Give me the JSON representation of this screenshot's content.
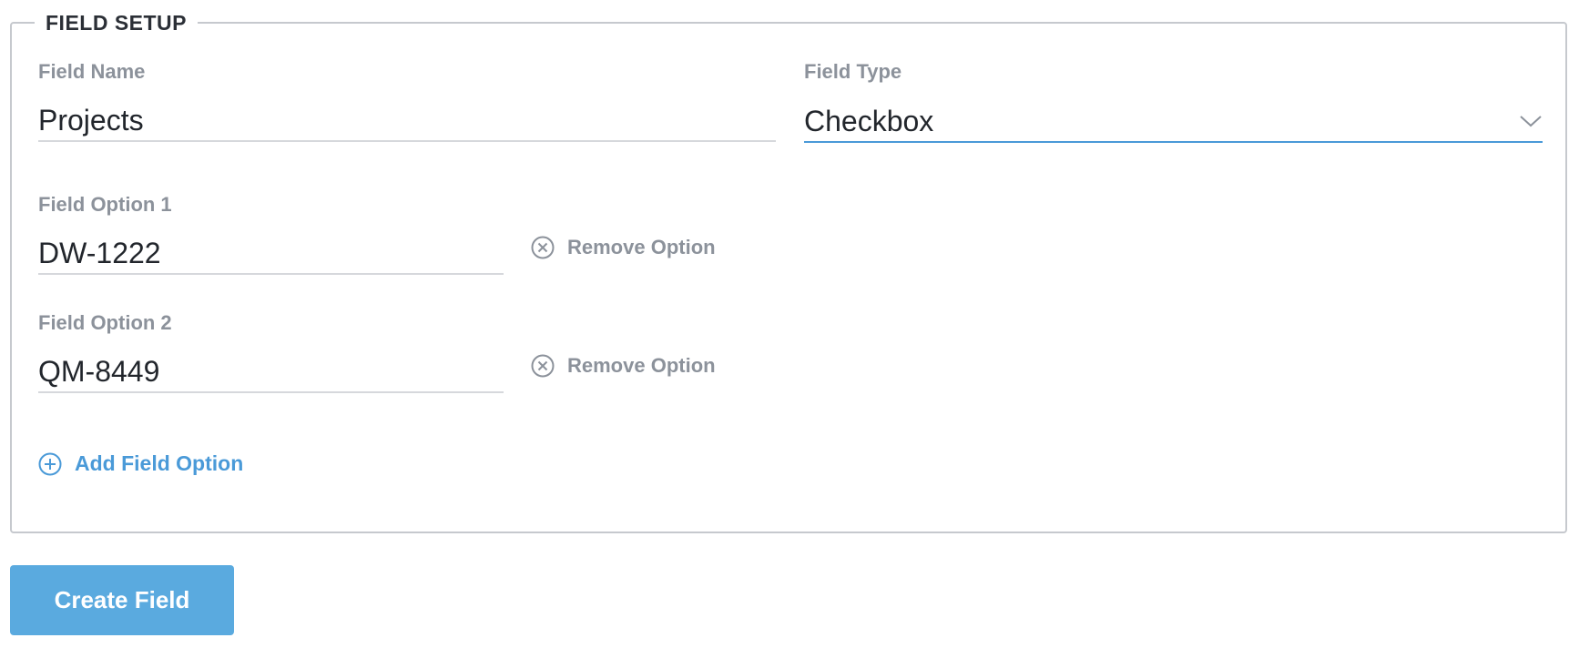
{
  "section": {
    "legend": "FIELD SETUP"
  },
  "field_name": {
    "label": "Field Name",
    "value": "Projects"
  },
  "field_type": {
    "label": "Field Type",
    "value": "Checkbox",
    "icon": "chevron-down-icon"
  },
  "options": [
    {
      "label": "Field Option 1",
      "value": "DW-1222",
      "remove_label": "Remove Option",
      "remove_icon": "circle-x-icon"
    },
    {
      "label": "Field Option 2",
      "value": "QM-8449",
      "remove_label": "Remove Option",
      "remove_icon": "circle-x-icon"
    }
  ],
  "add_option": {
    "label": "Add Field Option",
    "icon": "circle-plus-icon"
  },
  "submit": {
    "label": "Create Field"
  },
  "colors": {
    "accent": "#4a9ad8",
    "button": "#5aaadf",
    "muted": "#8c929b",
    "text": "#22262c"
  }
}
